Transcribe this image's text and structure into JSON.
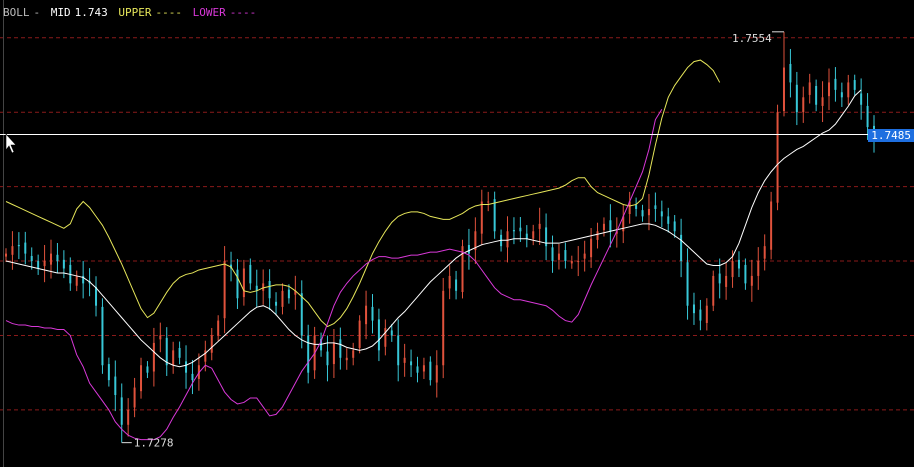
{
  "legend": {
    "name": "BOLL",
    "sep": "-",
    "mid_label": "MID",
    "mid_value": "1.743",
    "upper_label": "UPPER",
    "upper_dash": "----",
    "lower_label": "LOWER",
    "lower_dash": "----"
  },
  "crosshair_price": "1.7485",
  "colors": {
    "background": "#000000",
    "up": "#e0523c",
    "down": "#38c8d8",
    "mid": "#ffffff",
    "upper": "#e6e65a",
    "lower": "#d838d8",
    "grid": "#8a1a1a",
    "crosshair": "#ffffff",
    "price_tag": "#1e6fe0"
  },
  "chart_data": {
    "type": "candlestick",
    "indicator": "BOLL",
    "y_range": [
      1.7265,
      1.757
    ],
    "grid": "dashed horizontal",
    "max": {
      "label": "1.7554",
      "value": 1.7554
    },
    "min": {
      "label": "1.7278",
      "value": 1.7278
    },
    "crosshair_value": 1.7485,
    "series": {
      "close": [
        1.7405,
        1.741,
        1.741,
        1.7405,
        1.74,
        1.7395,
        1.74,
        1.7405,
        1.74,
        1.7395,
        1.7385,
        1.739,
        1.7385,
        1.7385,
        1.737,
        1.733,
        1.732,
        1.731,
        1.729,
        1.73,
        1.7315,
        1.733,
        1.7325,
        1.7345,
        1.735,
        1.733,
        1.734,
        1.7335,
        1.7325,
        1.732,
        1.733,
        1.734,
        1.735,
        1.736,
        1.74,
        1.7395,
        1.7375,
        1.7395,
        1.7385,
        1.738,
        1.7385,
        1.7375,
        1.737,
        1.738,
        1.7375,
        1.738,
        1.735,
        1.7325,
        1.735,
        1.734,
        1.733,
        1.7345,
        1.7335,
        1.7335,
        1.734,
        1.736,
        1.737,
        1.736,
        1.734,
        1.7355,
        1.735,
        1.733,
        1.7335,
        1.733,
        1.7325,
        1.733,
        1.732,
        1.733,
        1.738,
        1.739,
        1.738,
        1.741,
        1.7405,
        1.742,
        1.744,
        1.744,
        1.742,
        1.741,
        1.742,
        1.742,
        1.742,
        1.7415,
        1.742,
        1.7425,
        1.741,
        1.74,
        1.7405,
        1.74,
        1.74,
        1.74,
        1.7405,
        1.7415,
        1.742,
        1.7425,
        1.742,
        1.742,
        1.743,
        1.744,
        1.7435,
        1.743,
        1.7435,
        1.7435,
        1.743,
        1.7425,
        1.742,
        1.74,
        1.737,
        1.7365,
        1.736,
        1.737,
        1.739,
        1.7385,
        1.739,
        1.74,
        1.7395,
        1.7385,
        1.739,
        1.74,
        1.741,
        1.744,
        1.75,
        1.753,
        1.752,
        1.75,
        1.751,
        1.752,
        1.7505,
        1.751,
        1.752,
        1.7515,
        1.751,
        1.752,
        1.7515,
        1.7505,
        1.749,
        1.748
      ],
      "mid": [
        1.74,
        1.7399,
        1.7398,
        1.7397,
        1.7396,
        1.7395,
        1.7394,
        1.7393,
        1.7392,
        1.7392,
        1.7391,
        1.739,
        1.7389,
        1.7386,
        1.7382,
        1.7377,
        1.7372,
        1.7367,
        1.7362,
        1.7357,
        1.7352,
        1.7347,
        1.7343,
        1.7339,
        1.7335,
        1.7332,
        1.733,
        1.7329,
        1.733,
        1.7332,
        1.7335,
        1.7338,
        1.7342,
        1.7346,
        1.735,
        1.7354,
        1.7358,
        1.7362,
        1.7366,
        1.7369,
        1.737,
        1.7368,
        1.7364,
        1.7359,
        1.7354,
        1.735,
        1.7347,
        1.7345,
        1.7344,
        1.7344,
        1.7345,
        1.7345,
        1.7344,
        1.7342,
        1.7341,
        1.734,
        1.7341,
        1.7343,
        1.7347,
        1.7352,
        1.7357,
        1.7362,
        1.7366,
        1.7371,
        1.7376,
        1.7381,
        1.7386,
        1.739,
        1.7394,
        1.7398,
        1.7402,
        1.7405,
        1.7407,
        1.7409,
        1.7411,
        1.7412,
        1.7413,
        1.7414,
        1.7414,
        1.7415,
        1.7415,
        1.7415,
        1.7414,
        1.7413,
        1.7412,
        1.7412,
        1.7412,
        1.7413,
        1.7414,
        1.7415,
        1.7416,
        1.7417,
        1.7418,
        1.7419,
        1.742,
        1.7421,
        1.7422,
        1.7423,
        1.7424,
        1.7425,
        1.7425,
        1.7424,
        1.7422,
        1.742,
        1.7417,
        1.7414,
        1.741,
        1.7406,
        1.7402,
        1.7398,
        1.7397,
        1.7397,
        1.7399,
        1.7403,
        1.7412,
        1.7424,
        1.7436,
        1.7446,
        1.7454,
        1.746,
        1.7465,
        1.7469,
        1.7472,
        1.7475,
        1.7477,
        1.748,
        1.7483,
        1.7486,
        1.7488,
        1.7492,
        1.7498,
        1.7504,
        1.7511,
        1.7515
      ],
      "upper": [
        1.744,
        1.7438,
        1.7436,
        1.7434,
        1.7432,
        1.743,
        1.7428,
        1.7426,
        1.7424,
        1.7422,
        1.7425,
        1.7435,
        1.744,
        1.7436,
        1.743,
        1.7424,
        1.7416,
        1.7407,
        1.7398,
        1.7388,
        1.7378,
        1.7368,
        1.7362,
        1.7365,
        1.7372,
        1.7379,
        1.7385,
        1.7389,
        1.7391,
        1.7392,
        1.7394,
        1.7395,
        1.7396,
        1.7397,
        1.7398,
        1.7396,
        1.7389,
        1.738,
        1.7379,
        1.738,
        1.7382,
        1.7383,
        1.7384,
        1.7384,
        1.7383,
        1.738,
        1.7376,
        1.7372,
        1.7366,
        1.736,
        1.7356,
        1.7358,
        1.7362,
        1.7368,
        1.7376,
        1.7385,
        1.7395,
        1.7405,
        1.7413,
        1.742,
        1.7426,
        1.743,
        1.7432,
        1.7433,
        1.7433,
        1.7432,
        1.743,
        1.7429,
        1.7428,
        1.7428,
        1.743,
        1.7432,
        1.7435,
        1.7437,
        1.7438,
        1.7438,
        1.7439,
        1.744,
        1.7441,
        1.7442,
        1.7443,
        1.7444,
        1.7445,
        1.7446,
        1.7447,
        1.7448,
        1.7449,
        1.7451,
        1.7454,
        1.7456,
        1.7456,
        1.745,
        1.7446,
        1.7444,
        1.7442,
        1.744,
        1.7438,
        1.7437,
        1.7438,
        1.7442,
        1.7458,
        1.7478,
        1.7496,
        1.751,
        1.7518,
        1.7524,
        1.753,
        1.7534,
        1.7535,
        1.7532,
        1.7528,
        1.752
      ],
      "lower": [
        1.736,
        1.7358,
        1.7357,
        1.7357,
        1.7356,
        1.7356,
        1.7355,
        1.7355,
        1.7354,
        1.7354,
        1.735,
        1.7337,
        1.7329,
        1.7318,
        1.7312,
        1.7306,
        1.73,
        1.7292,
        1.7287,
        1.7283,
        1.7281,
        1.728,
        1.728,
        1.728,
        1.7282,
        1.7287,
        1.7295,
        1.7302,
        1.731,
        1.7318,
        1.7325,
        1.733,
        1.7328,
        1.732,
        1.7312,
        1.7307,
        1.7304,
        1.7305,
        1.7308,
        1.7308,
        1.7302,
        1.7296,
        1.7297,
        1.7302,
        1.731,
        1.7318,
        1.7326,
        1.7332,
        1.7338,
        1.7346,
        1.7358,
        1.737,
        1.7379,
        1.7385,
        1.739,
        1.7394,
        1.7398,
        1.7401,
        1.7403,
        1.7403,
        1.7402,
        1.7402,
        1.7403,
        1.7404,
        1.7404,
        1.7405,
        1.7406,
        1.7406,
        1.7407,
        1.7408,
        1.7407,
        1.7406,
        1.7404,
        1.74,
        1.7394,
        1.7388,
        1.7382,
        1.7378,
        1.7376,
        1.7374,
        1.7374,
        1.7373,
        1.7372,
        1.7371,
        1.737,
        1.7367,
        1.7363,
        1.736,
        1.7359,
        1.7364,
        1.7374,
        1.7384,
        1.7393,
        1.7402,
        1.7411,
        1.742,
        1.743,
        1.744,
        1.745,
        1.746,
        1.7475,
        1.7495,
        1.7502
      ]
    }
  }
}
